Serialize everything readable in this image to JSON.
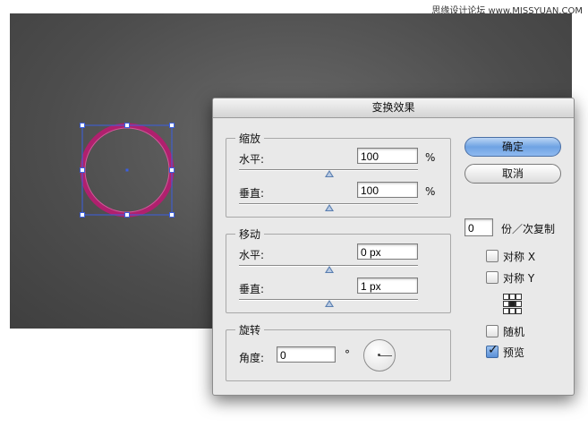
{
  "watermark": "思缘设计论坛 www.MISSYUAN.COM",
  "dialog": {
    "title": "变换效果",
    "scale": {
      "label": "缩放",
      "horizontal_label": "水平:",
      "horizontal_value": "100",
      "vertical_label": "垂直:",
      "vertical_value": "100",
      "unit": "%"
    },
    "move": {
      "label": "移动",
      "horizontal_label": "水平:",
      "horizontal_value": "0 px",
      "vertical_label": "垂直:",
      "vertical_value": "1 px"
    },
    "rotate": {
      "label": "旋转",
      "angle_label": "角度:",
      "angle_value": "0",
      "degree_symbol": "°"
    },
    "buttons": {
      "ok": "确定",
      "cancel": "取消"
    },
    "copies": {
      "value": "0",
      "label": "份／次复制"
    },
    "options": {
      "reflect_x": {
        "label": "对称 X",
        "checked": false
      },
      "reflect_y": {
        "label": "对称 Y",
        "checked": false
      },
      "random": {
        "label": "随机",
        "checked": false
      },
      "preview": {
        "label": "预览",
        "checked": true
      }
    }
  },
  "colors": {
    "canvas": "#4d4d4d",
    "circle_stroke": "#c0257a",
    "selection": "#3b5fe0",
    "primary_button": "#6fa3e3"
  }
}
